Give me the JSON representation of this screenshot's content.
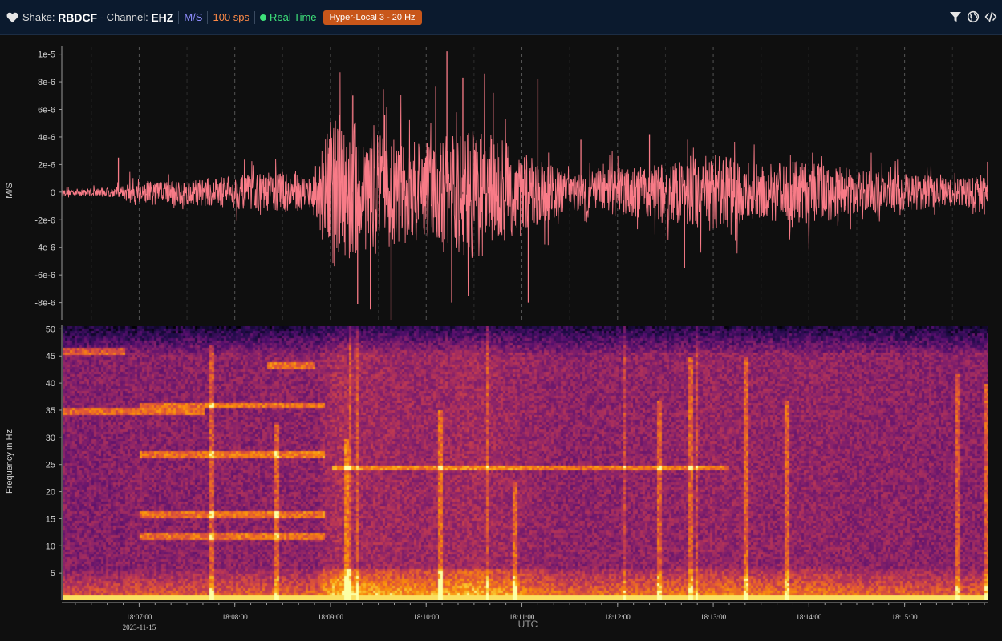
{
  "header": {
    "shake_label": "Shake:",
    "station": "RBDCF",
    "channel_label": "- Channel:",
    "channel": "EHZ",
    "units": "M/S",
    "sps": "100 sps",
    "realtime": "Real Time",
    "filter": "Hyper-Local 3 - 20 Hz"
  },
  "icons": [
    "heart-icon",
    "filter-icon",
    "globe-icon",
    "code-icon"
  ],
  "colors": {
    "waveform": "#f87b87",
    "badge": "#c8561a",
    "units": "#8f8dff",
    "sps": "#ff8a47",
    "realtime": "#3ee07a",
    "topbar": "#0b1a2e",
    "background": "#0f0f0f"
  },
  "chart_data": [
    {
      "type": "line",
      "name": "waveform",
      "ylabel": "M/S",
      "yticks": [
        "1e-5",
        "8e-6",
        "6e-6",
        "4e-6",
        "2e-6",
        "0",
        "-2e-6",
        "-4e-6",
        "-6e-6",
        "-8e-6"
      ],
      "yvalues": [
        1e-05,
        8e-06,
        6e-06,
        4e-06,
        2e-06,
        0,
        -2e-06,
        -4e-06,
        -6e-06,
        -8e-06
      ],
      "ylim": [
        -9.3e-06,
        1.05e-05
      ],
      "xlim": [
        "18:06:12",
        "18:15:52"
      ],
      "grid_x": true,
      "envelope": {
        "t_seconds_from_18_06": [
          12,
          50,
          55,
          60,
          90,
          150,
          170,
          175,
          185,
          200,
          220,
          240,
          270,
          300,
          330,
          360,
          390,
          420,
          450,
          480,
          510,
          540,
          570,
          590
        ],
        "amplitude": [
          2e-07,
          4e-07,
          1.2e-06,
          8e-07,
          9e-07,
          1.5e-06,
          1.2e-06,
          3.5e-06,
          6e-06,
          4.5e-06,
          4e-06,
          3.5e-06,
          5e-06,
          3e-06,
          1.3e-06,
          1.8e-06,
          2e-06,
          2.8e-06,
          2e-06,
          2.4e-06,
          1.6e-06,
          1.4e-06,
          1e-06,
          1.3e-06
        ]
      },
      "spikes": [
        {
          "t": 47,
          "v": 2.5e-06
        },
        {
          "t": 179,
          "v": 3.2e-06
        },
        {
          "t": 194,
          "v": 7e-06
        },
        {
          "t": 197,
          "v": -8.1e-06
        },
        {
          "t": 205,
          "v": -8.5e-06
        },
        {
          "t": 214,
          "v": 5.6e-06
        },
        {
          "t": 218,
          "v": -9.3e-06
        },
        {
          "t": 246,
          "v": 7.7e-06
        },
        {
          "t": 253,
          "v": 1.02e-05
        },
        {
          "t": 256,
          "v": -8e-06
        },
        {
          "t": 263,
          "v": 8.3e-06
        },
        {
          "t": 282,
          "v": 7.2e-06
        },
        {
          "t": 304,
          "v": -8e-06
        },
        {
          "t": 310,
          "v": 8.2e-06
        },
        {
          "t": 337,
          "v": 3.8e-06
        },
        {
          "t": 380,
          "v": 4.2e-06
        },
        {
          "t": 402,
          "v": -5.5e-06
        },
        {
          "t": 404,
          "v": 3.8e-06
        },
        {
          "t": 470,
          "v": 2.2e-06
        },
        {
          "t": 592,
          "v": 2.2e-06
        },
        {
          "t": 590,
          "v": -1.6e-06
        }
      ]
    },
    {
      "type": "heatmap",
      "name": "spectrogram",
      "ylabel": "Frequency in Hz",
      "yticks": [
        "50",
        "45",
        "40",
        "35",
        "30",
        "25",
        "20",
        "15",
        "10",
        "5"
      ],
      "yvalues": [
        50,
        45,
        40,
        35,
        30,
        25,
        20,
        15,
        10,
        5
      ],
      "ylim": [
        0,
        50.5
      ],
      "colormap": "inferno",
      "lines": [
        {
          "from": 180,
          "to": 430,
          "f": 24.5
        },
        {
          "from": 12,
          "to": 50,
          "f": 46
        },
        {
          "from": 12,
          "to": 100,
          "f": 35
        },
        {
          "from": 60,
          "to": 175,
          "f": 36
        },
        {
          "from": 60,
          "to": 175,
          "f": 27
        },
        {
          "from": 60,
          "to": 175,
          "f": 16
        },
        {
          "from": 60,
          "to": 175,
          "f": 12
        },
        {
          "from": 140,
          "to": 170,
          "f": 43.5
        }
      ],
      "vertical_events": [
        {
          "t": 105,
          "f_max": 47
        },
        {
          "t": 145,
          "f_max": 33
        },
        {
          "t": 190,
          "f_max": 30
        },
        {
          "t": 248,
          "f_max": 35
        },
        {
          "t": 295,
          "f_max": 22
        },
        {
          "t": 385,
          "f_max": 37
        },
        {
          "t": 405,
          "f_max": 45
        },
        {
          "t": 440,
          "f_max": 45
        },
        {
          "t": 465,
          "f_max": 37
        },
        {
          "t": 572,
          "f_max": 42
        },
        {
          "t": 591,
          "f_max": 40
        }
      ]
    }
  ],
  "x_axis": {
    "ticks": [
      "18:07:00",
      "18:08:00",
      "18:09:00",
      "18:10:00",
      "18:11:00",
      "18:12:00",
      "18:13:00",
      "18:14:00",
      "18:15:00"
    ],
    "tick_seconds": [
      60,
      120,
      180,
      240,
      300,
      360,
      420,
      480,
      540
    ],
    "date": "2023-11-15",
    "label": "UTC",
    "range_seconds": [
      12,
      592
    ]
  }
}
